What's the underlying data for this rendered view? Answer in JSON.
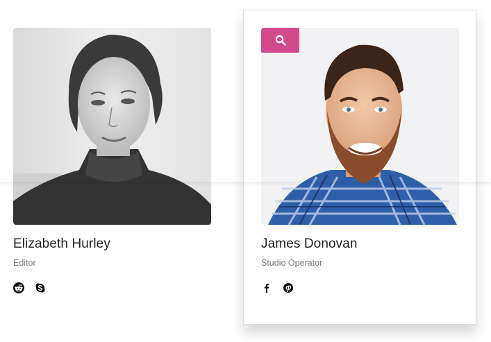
{
  "colors": {
    "accent": "#d34a8c",
    "text": "#222222",
    "muted": "#7a7a7a"
  },
  "team": [
    {
      "name": "Elizabeth Hurley",
      "role": "Editor",
      "socials": [
        "reddit-icon",
        "skype-icon"
      ]
    },
    {
      "name": "James Donovan",
      "role": "Studio Operator",
      "socials": [
        "facebook-icon",
        "pinterest-icon"
      ],
      "overlay_icon": "search-icon"
    }
  ]
}
